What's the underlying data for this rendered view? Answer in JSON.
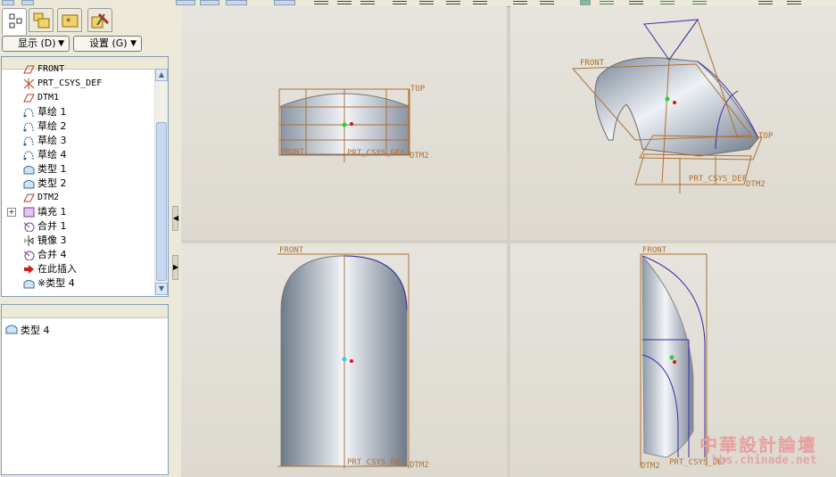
{
  "toolbar": {
    "buttons": [
      "view-1",
      "view-2",
      "view-3",
      "view-4",
      "view-5",
      "view-6"
    ]
  },
  "tabs": [
    {
      "icon": "model-tree-icon",
      "active": true
    },
    {
      "icon": "folder-tree-icon",
      "active": false
    },
    {
      "icon": "favorites-icon",
      "active": false
    },
    {
      "icon": "tools-icon",
      "active": false
    }
  ],
  "dropdowns": {
    "display": "显示 (D)",
    "settings": "设置 (G)"
  },
  "tree": {
    "items": [
      {
        "label": "FRONT",
        "icon": "datum-plane-icon",
        "mono": true,
        "partial": true
      },
      {
        "label": "PRT_CSYS_DEF",
        "icon": "csys-icon",
        "mono": true
      },
      {
        "label": "DTM1",
        "icon": "datum-plane-icon",
        "mono": true
      },
      {
        "label": "草绘 1",
        "icon": "sketch-icon"
      },
      {
        "label": "草绘 2",
        "icon": "sketch-icon"
      },
      {
        "label": "草绘 3",
        "icon": "sketch-icon"
      },
      {
        "label": "草绘 4",
        "icon": "sketch-icon"
      },
      {
        "label": "类型 1",
        "icon": "surface-icon"
      },
      {
        "label": "类型 2",
        "icon": "surface-icon"
      },
      {
        "label": "DTM2",
        "icon": "datum-plane-icon",
        "mono": true
      },
      {
        "label": "填充 1",
        "icon": "fill-icon",
        "expandable": true
      },
      {
        "label": "合并 1",
        "icon": "merge-icon"
      },
      {
        "label": "镜像 3",
        "icon": "mirror-icon"
      },
      {
        "label": "合并 4",
        "icon": "merge-icon"
      },
      {
        "label": "在此插入",
        "icon": "insert-arrow-icon"
      },
      {
        "label": "※类型 4",
        "icon": "surface-icon"
      }
    ]
  },
  "selection": {
    "label": "类型 4",
    "icon": "surface-icon"
  },
  "viewports": {
    "top_left": {
      "labels": [
        "TOP",
        "FRONT",
        "PRT_CSYS_DEF",
        "DTM2"
      ]
    },
    "top_right": {
      "labels": [
        "FRONT",
        "TOP",
        "PRT_CSYS_DEF",
        "DTM2"
      ]
    },
    "bottom_left": {
      "labels": [
        "FRONT",
        "PRT_CSYS_DEF",
        "DTM2"
      ]
    },
    "bottom_right": {
      "labels": [
        "FRONT",
        "DTM2",
        "PRT_CSYS_DEF"
      ]
    }
  },
  "watermark": {
    "title": "中華設計論壇",
    "url": "bbs.chinade.net"
  },
  "colors": {
    "datum": "#b07030",
    "curve": "#3a2aa8",
    "surface": "#aeb8c6"
  }
}
